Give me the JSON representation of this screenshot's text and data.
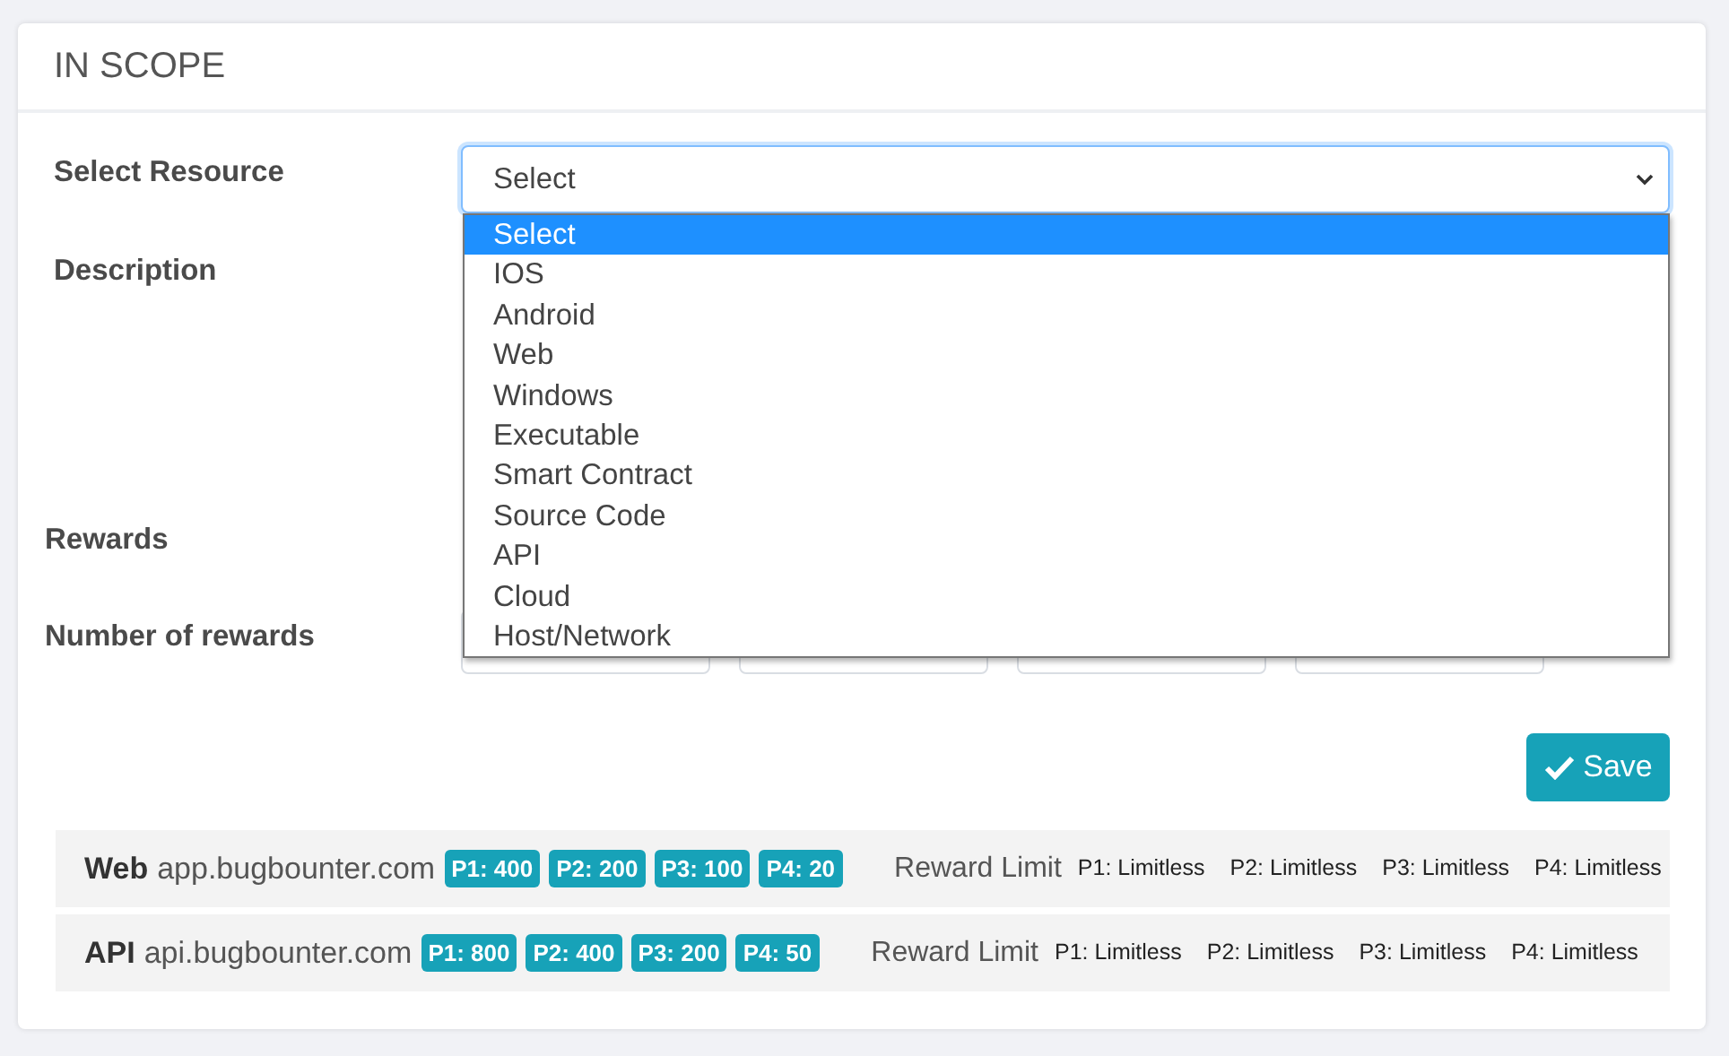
{
  "card": {
    "title": "IN SCOPE"
  },
  "form": {
    "resource_label": "Select Resource",
    "select": {
      "value": "Select",
      "expanded": true,
      "options": [
        {
          "label": "Select",
          "selected": true
        },
        {
          "label": "IOS",
          "selected": false
        },
        {
          "label": "Android",
          "selected": false
        },
        {
          "label": "Web",
          "selected": false
        },
        {
          "label": "Windows",
          "selected": false
        },
        {
          "label": "Executable",
          "selected": false
        },
        {
          "label": "Smart Contract",
          "selected": false
        },
        {
          "label": "Source Code",
          "selected": false
        },
        {
          "label": "API",
          "selected": false
        },
        {
          "label": "Cloud",
          "selected": false
        },
        {
          "label": "Host/Network",
          "selected": false
        }
      ]
    },
    "description_label": "Description",
    "rewards_label": "Rewards",
    "number_of_rewards_label": "Number of rewards"
  },
  "save_button": "Save",
  "scopes": [
    {
      "type": "Web",
      "target": "app.bugbounter.com",
      "rewards": [
        "P1: 400",
        "P2: 200",
        "P3: 100",
        "P4: 20"
      ],
      "limit_label": "Reward Limit",
      "limits": [
        "P1: Limitless",
        "P2: Limitless",
        "P3: Limitless",
        "P4: Limitless"
      ]
    },
    {
      "type": "API",
      "target": "api.bugbounter.com",
      "rewards": [
        "P1: 800",
        "P2: 400",
        "P3: 200",
        "P4: 50"
      ],
      "limit_label": "Reward Limit",
      "limits": [
        "P1: Limitless",
        "P2: Limitless",
        "P3: Limitless",
        "P4: Limitless"
      ]
    }
  ]
}
